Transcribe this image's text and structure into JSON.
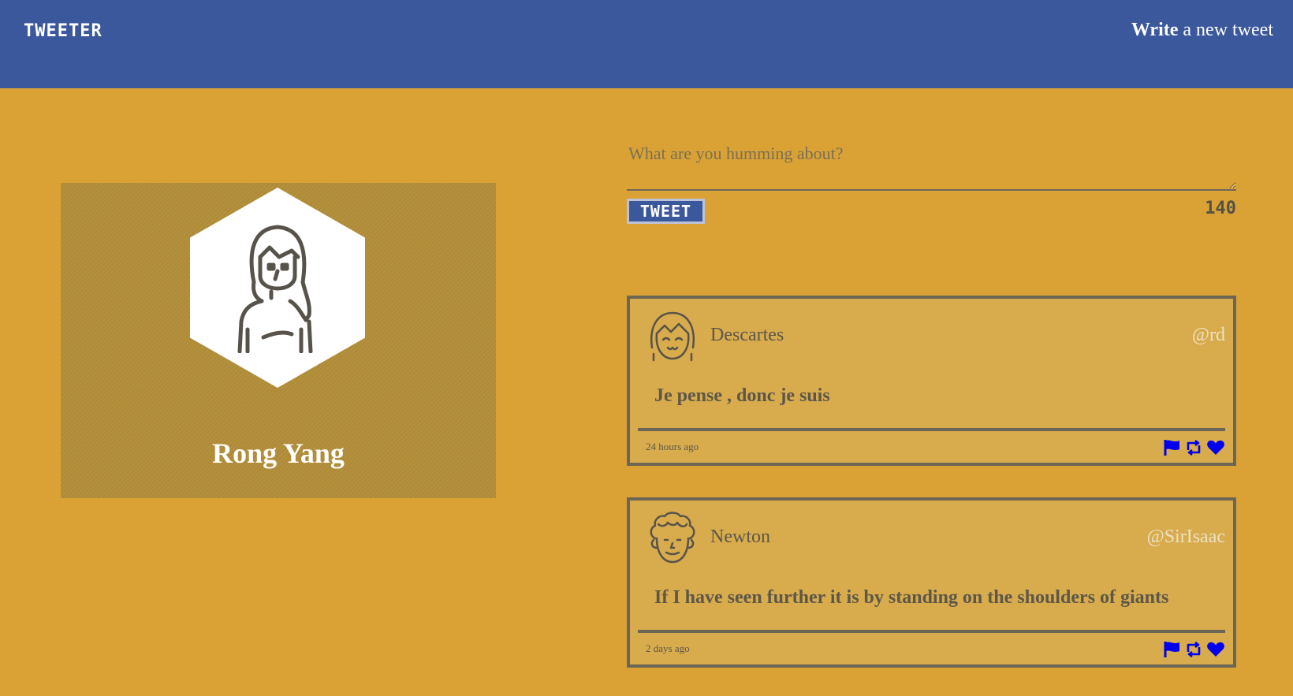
{
  "nav": {
    "brand": "TWEETER",
    "compose_bold": "Write",
    "compose_rest": " a new tweet"
  },
  "profile": {
    "name": "Rong Yang",
    "avatar_icon": "woman-avatar-icon"
  },
  "composer": {
    "placeholder": "What are you humming about?",
    "button_label": "TWEET",
    "char_count": "140"
  },
  "tweets": [
    {
      "author": "Descartes",
      "handle": "@rd",
      "text": "Je pense , donc je suis",
      "time": "24 hours ago",
      "avatar_icon": "smiling-girl-avatar-icon"
    },
    {
      "author": "Newton",
      "handle": "@SirIsaac",
      "text": "If I have seen further it is by standing on the shoulders of giants",
      "time": "2 days ago",
      "avatar_icon": "curly-hair-man-avatar-icon"
    }
  ],
  "actions": [
    "flag-icon",
    "retweet-icon",
    "heart-icon"
  ],
  "colors": {
    "nav": "#3c589c",
    "page": "#daa234",
    "card": "#d8ab4d",
    "action_icons": "#0000ee"
  }
}
